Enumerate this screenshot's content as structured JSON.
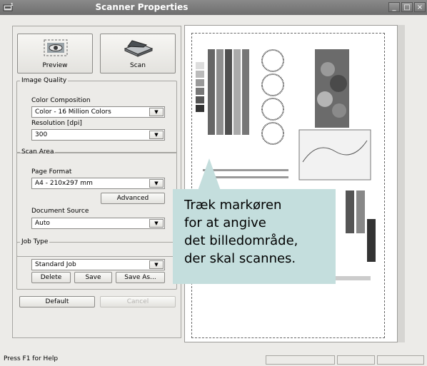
{
  "window": {
    "title": "Scanner Properties"
  },
  "buttons": {
    "preview": "Preview",
    "scan": "Scan",
    "advanced": "Advanced",
    "delete": "Delete",
    "save": "Save",
    "save_as": "Save As...",
    "default": "Default",
    "cancel": "Cancel"
  },
  "image_quality": {
    "legend": "Image Quality",
    "color_label": "Color Composition",
    "color_value": "Color - 16 Million Colors",
    "resolution_label": "Resolution [dpi]",
    "resolution_value": "300"
  },
  "scan_area": {
    "legend": "Scan Area",
    "page_format_label": "Page Format",
    "page_format_value": "A4 - 210x297 mm",
    "source_label": "Document Source",
    "source_value": "Auto"
  },
  "job_type": {
    "legend": "Job Type",
    "value": "Standard Job"
  },
  "status": {
    "text": "Press F1 for Help"
  },
  "callout": {
    "lines": [
      "Træk markøren",
      "for at angive",
      "det billedområde,",
      "der skal scannes."
    ]
  },
  "colors": {
    "titlebar": "#7a7a7a",
    "panel": "#ecebe8",
    "callout": "#c4dedd"
  },
  "icons": [
    "scanner-app-icon",
    "preview-eye-icon",
    "scanner-icon",
    "minimize-icon",
    "maximize-icon",
    "close-icon",
    "dropdown-arrow-icon"
  ]
}
